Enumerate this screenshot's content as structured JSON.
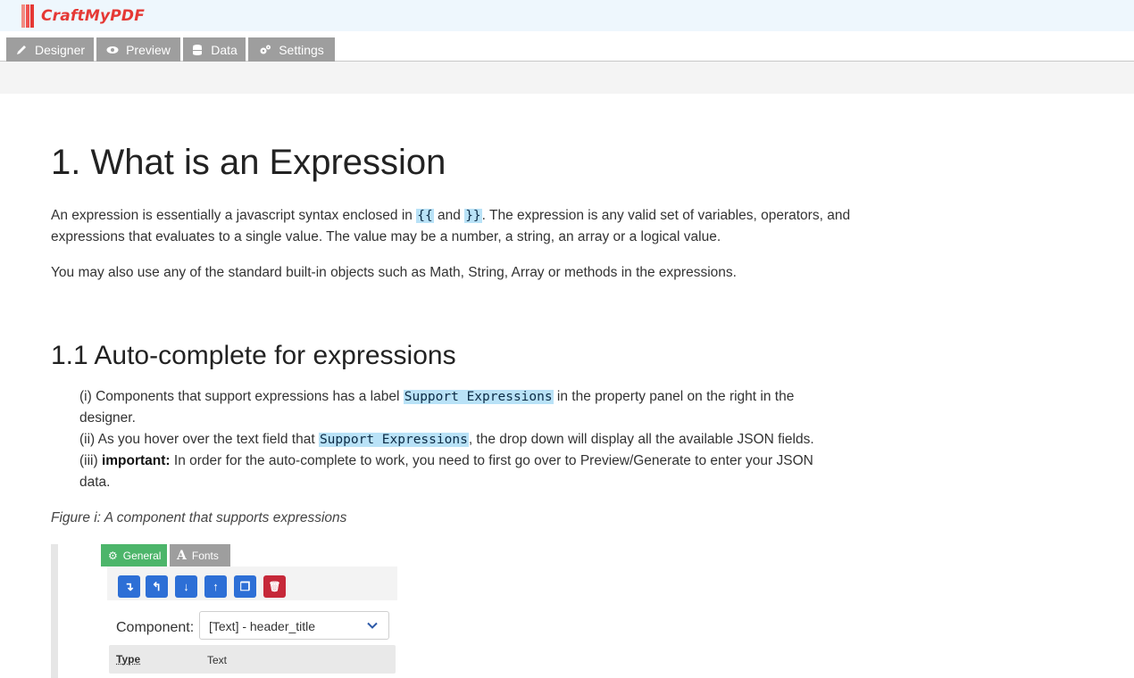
{
  "header": {
    "logo_text": "CraftMyPDF"
  },
  "tabs": [
    {
      "label": "Designer",
      "icon": "pencil-icon"
    },
    {
      "label": "Preview",
      "icon": "eye-icon"
    },
    {
      "label": "Data",
      "icon": "database-icon"
    },
    {
      "label": "Settings",
      "icon": "gears-icon"
    }
  ],
  "doc": {
    "title": "1. What is an Expression",
    "p1_a": "An expression is essentially a javascript syntax enclosed in ",
    "p1_code1": "{{",
    "p1_b": " and ",
    "p1_code2": "}}",
    "p1_c": ". The expression is any valid set of variables, operators, and expressions that evaluates to a single value. The value may be a number, a string, an array or a logical value.",
    "p2": "You may also use any of the standard built-in objects such as Math, String, Array or methods in the expressions.",
    "subtitle": "1.1 Auto-complete for expressions",
    "li1_a": "(i) Components that support expressions has a label ",
    "li1_code": "Support Expressions",
    "li1_b": " in the property panel on the right in the designer.",
    "li2_a": "(ii) As you hover over the text field that ",
    "li2_code": "Support Expressions",
    "li2_b": ", the drop down will display all the available JSON fields.",
    "li3_a": "(iii) ",
    "li3_bold": "important:",
    "li3_b": " In order for the auto-complete to work, you need to first go over to Preview/Generate to enter your JSON data.",
    "caption": "Figure i: A component that supports expressions"
  },
  "figure": {
    "tab_general": "General",
    "tab_fonts": "Fonts",
    "buttons": [
      {
        "icon": "move-down-icon",
        "glyph": "↴",
        "color": "#2d6fd6"
      },
      {
        "icon": "move-up-icon",
        "glyph": "↰",
        "color": "#2d6fd6"
      },
      {
        "icon": "arrow-down-icon",
        "glyph": "↓",
        "color": "#2d6fd6"
      },
      {
        "icon": "arrow-up-icon",
        "glyph": "↑",
        "color": "#2d6fd6"
      },
      {
        "icon": "copy-icon",
        "glyph": "❐",
        "color": "#2d6fd6"
      },
      {
        "icon": "trash-icon",
        "glyph": "🗑",
        "color": "#c62839"
      }
    ],
    "component_label": "Component:",
    "component_value": "[Text] - header_title",
    "prop_type_key": "Type",
    "prop_type_value": "Text"
  },
  "colors": {
    "tab_bg": "#9e9e9e",
    "general_tab": "#4cb56a",
    "fonts_tab": "#9e9e9e",
    "highlight": "#b9e2f7",
    "logo": "#e53935"
  }
}
